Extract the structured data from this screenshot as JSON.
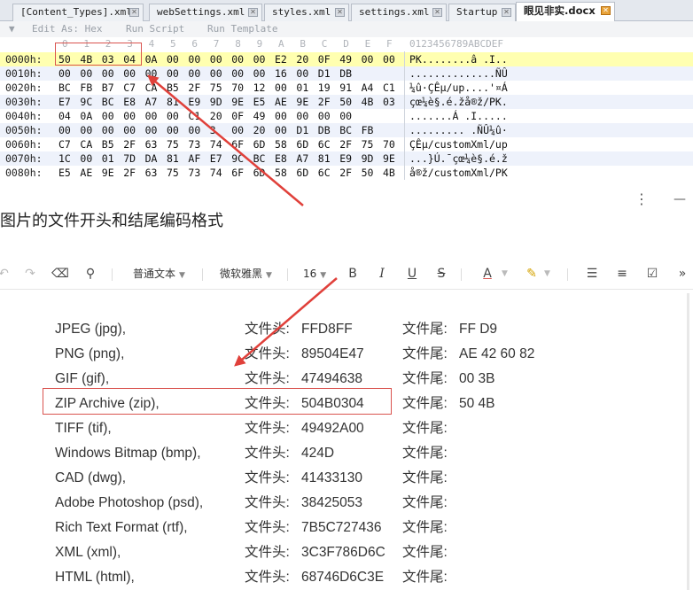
{
  "hex_editor": {
    "tabs": [
      {
        "label": "[Content_Types].xml",
        "active": false
      },
      {
        "label": "webSettings.xml",
        "active": false
      },
      {
        "label": "styles.xml",
        "active": false
      },
      {
        "label": "settings.xml",
        "active": false
      },
      {
        "label": "Startup",
        "active": false
      },
      {
        "label": "眼见非实.docx",
        "active": true
      }
    ],
    "toolbar": {
      "edit_as": "Edit As: Hex",
      "run_script": "Run Script",
      "run_template": "Run Template"
    },
    "column_header": [
      "0",
      "1",
      "2",
      "3",
      "4",
      "5",
      "6",
      "7",
      "8",
      "9",
      "A",
      "B",
      "C",
      "D",
      "E",
      "F"
    ],
    "ascii_header": "0123456789ABCDEF",
    "rows": [
      {
        "offset": "0000h:",
        "bytes": [
          "50",
          "4B",
          "03",
          "04",
          "0A",
          "00",
          "00",
          "00",
          "00",
          "00",
          "E2",
          "20",
          "0F",
          "49",
          "00",
          "00"
        ],
        "ascii": "PK........â .I.."
      },
      {
        "offset": "0010h:",
        "bytes": [
          "00",
          "00",
          "00",
          "00",
          "00",
          "00",
          "00",
          "00",
          "00",
          "00",
          "16",
          "00",
          "D1",
          "DB"
        ],
        "ascii": "..............ÑÛ"
      },
      {
        "offset": "0020h:",
        "bytes": [
          "BC",
          "FB",
          "B7",
          "C7",
          "CA",
          "B5",
          "2F",
          "75",
          "70",
          "12",
          "00",
          "01",
          "19",
          "91",
          "A4",
          "C1"
        ],
        "ascii": "¼û·ÇÊµ/up....'¤Á"
      },
      {
        "offset": "0030h:",
        "bytes": [
          "E7",
          "9C",
          "BC",
          "E8",
          "A7",
          "81",
          "E9",
          "9D",
          "9E",
          "E5",
          "AE",
          "9E",
          "2F",
          "50",
          "4B",
          "03"
        ],
        "ascii": "çœ¼è§.é.žå®ž/PK."
      },
      {
        "offset": "0040h:",
        "bytes": [
          "04",
          "0A",
          "00",
          "00",
          "00",
          "00",
          "C1",
          "20",
          "0F",
          "49",
          "00",
          "00",
          "00",
          "00"
        ],
        "ascii": ".......Á .I....."
      },
      {
        "offset": "0050h:",
        "bytes": [
          "00",
          "00",
          "00",
          "00",
          "00",
          "00",
          "00",
          "3",
          "00",
          "20",
          "00",
          "D1",
          "DB",
          "BC",
          "FB"
        ],
        "ascii": "......... .ÑÛ¼û·"
      },
      {
        "offset": "0060h:",
        "bytes": [
          "C7",
          "CA",
          "B5",
          "2F",
          "63",
          "75",
          "73",
          "74",
          "6F",
          "6D",
          "58",
          "6D",
          "6C",
          "2F",
          "75",
          "70"
        ],
        "ascii": "ÇÊµ/customXml/up"
      },
      {
        "offset": "0070h:",
        "bytes": [
          "1C",
          "00",
          "01",
          "7D",
          "DA",
          "81",
          "AF",
          "E7",
          "9C",
          "BC",
          "E8",
          "A7",
          "81",
          "E9",
          "9D",
          "9E"
        ],
        "ascii": "...}Ú.¯çœ¼è§.é.ž"
      },
      {
        "offset": "0080h:",
        "bytes": [
          "E5",
          "AE",
          "9E",
          "2F",
          "63",
          "75",
          "73",
          "74",
          "6F",
          "6D",
          "58",
          "6D",
          "6C",
          "2F",
          "50",
          "4B"
        ],
        "ascii": "å®ž/customXml/PK"
      }
    ]
  },
  "document": {
    "title": "图片的文件开头和结尾编码格式",
    "toolbar": {
      "paragraph_style": "普通文本",
      "font_name": "微软雅黑",
      "font_size": "16",
      "bold": "B",
      "italic": "I",
      "underline": "U",
      "strike": "S",
      "font_color": "A"
    },
    "head_label": "文件头:",
    "tail_label": "文件尾:",
    "rows": [
      {
        "name": "JPEG (jpg),",
        "head": "FFD8FF",
        "tail": "FF D9"
      },
      {
        "name": "PNG (png),",
        "head": "89504E47",
        "tail": "AE 42 60 82"
      },
      {
        "name": "GIF (gif),",
        "head": "47494638",
        "tail": "00 3B"
      },
      {
        "name": "ZIP Archive (zip),",
        "head": "504B0304",
        "tail": "50 4B"
      },
      {
        "name": "TIFF (tif),",
        "head": "49492A00",
        "tail": ""
      },
      {
        "name": "Windows Bitmap (bmp),",
        "head": "424D",
        "tail": ""
      },
      {
        "name": "CAD (dwg),",
        "head": "41433130",
        "tail": ""
      },
      {
        "name": "Adobe Photoshop (psd),",
        "head": "38425053",
        "tail": ""
      },
      {
        "name": "Rich Text Format (rtf),",
        "head": "7B5C727436",
        "tail": ""
      },
      {
        "name": "XML (xml),",
        "head": "3C3F786D6C",
        "tail": ""
      },
      {
        "name": "HTML (html),",
        "head": "68746D6C3E",
        "tail": ""
      }
    ]
  },
  "colors": {
    "highlight_box": "#d9534f",
    "arrow": "#e0403a",
    "hex_first_row_bg": "#ffffb0",
    "alt_row_bg": "#eef2fb"
  }
}
